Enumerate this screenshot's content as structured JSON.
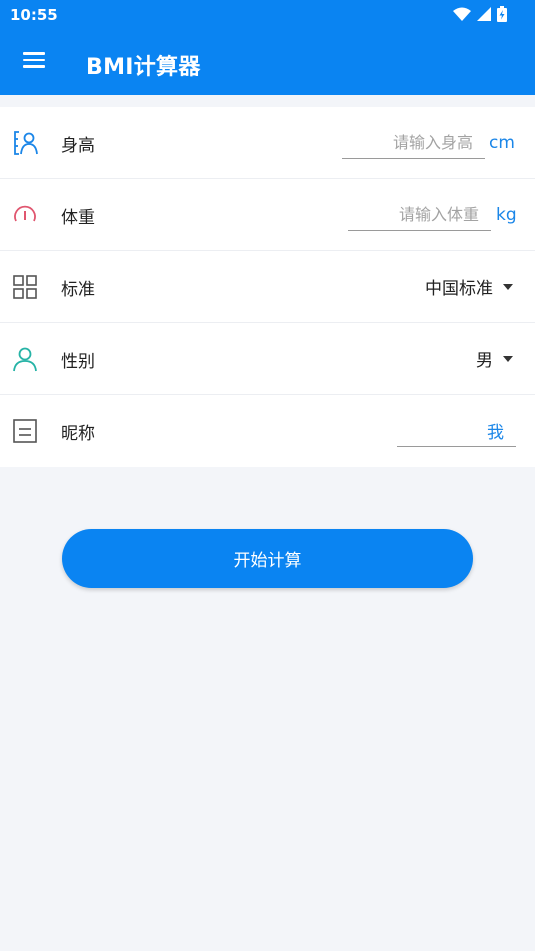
{
  "status_bar": {
    "time": "10:55"
  },
  "app_bar": {
    "title": "BMI计算器"
  },
  "form": {
    "height": {
      "label": "身高",
      "placeholder": "请输入身高",
      "value": "",
      "unit": "cm"
    },
    "weight": {
      "label": "体重",
      "placeholder": "请输入体重",
      "value": "",
      "unit": "kg"
    },
    "standard": {
      "label": "标准",
      "selected": "中国标准"
    },
    "gender": {
      "label": "性别",
      "selected": "男"
    },
    "nickname": {
      "label": "昵称",
      "value": "我"
    }
  },
  "actions": {
    "start_label": "开始计算"
  },
  "colors": {
    "primary": "#0a84f2",
    "accent_text": "#1b86e8",
    "weight_icon": "#e0566f",
    "gender_icon": "#26b3a6"
  },
  "icons": {
    "height": "person-ruler-icon",
    "weight": "gauge-icon",
    "standard": "grid-icon",
    "gender": "person-icon",
    "nickname": "note-icon"
  }
}
